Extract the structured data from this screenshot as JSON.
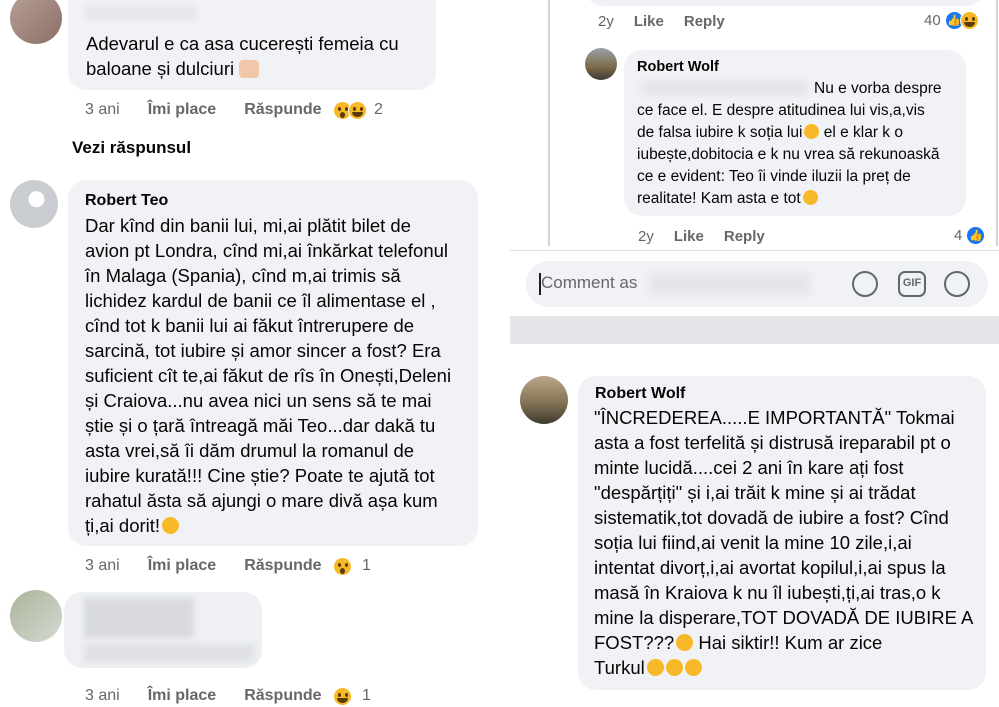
{
  "left": {
    "comment1": {
      "text": "Adevarul  e ca asa cucerești  femeia  cu baloane și dulciuri",
      "time": "3 ani",
      "like": "Îmi place",
      "reply": "Răspunde",
      "reactions": "2"
    },
    "see_reply": "Vezi răspunsul",
    "comment2": {
      "name": "Robert Teo",
      "text": "Dar kînd din banii lui, mi,ai plătit bilet de\navion pt Londra, cînd mi,ai înkărkat telefonul\nîn Malaga (Spania), cînd m,ai trimis să\nlichidez kardul de banii ce îl alimentase el ,\ncînd tot k banii lui ai făkut întrerupere de\nsarcină, tot iubire și amor sincer a fost?  Era\nsuficient cît te,ai făkut de rîs în Onești,Deleni\nși Craiova...nu avea nici un sens să te mai\nștie și o țară întreagă măi Teo...dar dakă tu\nasta vrei,să îi dăm drumul la romanul de\niubire kurată!!! Cine știe? Poate te ajută tot\nrahatul ăsta să ajungi o mare divă așa kum\nți,ai dorit!",
      "time": "3 ani",
      "like": "Îmi place",
      "reply": "Răspunde",
      "reactions": "1"
    },
    "comment3": {
      "time": "3 ani",
      "like": "Îmi place",
      "reply": "Răspunde",
      "reactions": "1"
    }
  },
  "right_top": {
    "prev_meta": {
      "time": "2y",
      "like": "Like",
      "reply": "Reply",
      "reactions": "40"
    },
    "comment": {
      "name": "Robert Wolf",
      "text_first": "Nu e vorba despre",
      "text": "ce face el. E despre atitudinea lui vis,a,vis\nde falsa iubire k soția lui",
      "text_cont": " el  e klar k o\niubește,dobitocia e k nu vrea să rekunoaskă\nce e evident: Teo îi vinde iluzii la preț de\nrealitate! Kam asta e tot",
      "time": "2y",
      "like": "Like",
      "reply": "Reply",
      "reactions": "4"
    },
    "composer_placeholder": "Comment as",
    "gif_label": "GIF"
  },
  "right_bottom": {
    "comment": {
      "name": "Robert Wolf",
      "text": "\"ÎNCREDEREA.....E IMPORTANTĂ\" Tokmai\nasta a fost terfelită și distrusă ireparabil pt o\nminte lucidă....cei 2 ani în kare ați fost\n\"despărțiți\" și i,ai trăit k mine și ai trădat\nsistematik,tot dovadă de iubire a fost? Cînd\nsoția lui fiind,ai venit la mine 10 zile,i,ai\nintentat divorț,i,ai avortat kopilul,i,ai spus la\nmasă în Kraiova k nu îl iubești,ți,ai tras,o k\nmine la disperare,TOT DOVADĂ DE IUBIRE A\nFOST???",
      "text_tail": " Hai siktir!! Kum ar zice\nTurkul"
    }
  },
  "colors": {
    "bubble": "#f0f2f5",
    "meta_text": "#65676b",
    "accent": "#1877f2",
    "emoji": "#f7b928"
  }
}
